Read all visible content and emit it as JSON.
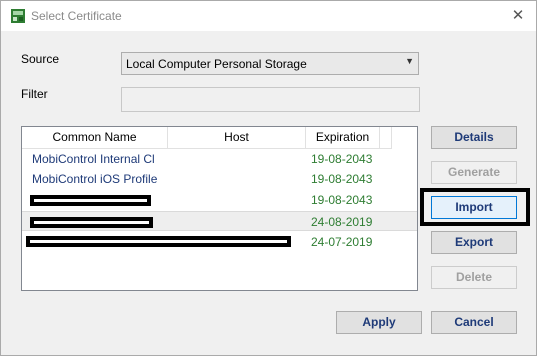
{
  "window": {
    "title": "Select Certificate",
    "close_glyph": "✕",
    "app_icon": "certificate-app-icon"
  },
  "source": {
    "label": "Source",
    "value": "Local Computer Personal Storage",
    "arrow": "▼"
  },
  "filter": {
    "label": "Filter",
    "value": ""
  },
  "list": {
    "columns": [
      "Common Name",
      "Host",
      "Expiration"
    ],
    "rows": [
      {
        "name": "MobiControl Internal Cl",
        "host": "",
        "expiration": "19-08-2043",
        "redacted": false
      },
      {
        "name": "MobiControl iOS Profile",
        "host": "",
        "expiration": "19-08-2043",
        "redacted": false
      },
      {
        "name": "",
        "host": "",
        "expiration": "19-08-2043",
        "redacted": true
      },
      {
        "name": "",
        "host": "",
        "expiration": "24-08-2019",
        "redacted": true,
        "selected": true
      },
      {
        "name": "",
        "host": "",
        "expiration": "24-07-2019",
        "redacted": true
      }
    ]
  },
  "buttons": {
    "details": "Details",
    "generate": "Generate",
    "import": "Import",
    "export": "Export",
    "delete": "Delete",
    "apply": "Apply",
    "cancel": "Cancel"
  },
  "colors": {
    "link_text": "#1e3a78",
    "expiration_text": "#2e7d32",
    "disabled_text": "#a0a0a0"
  }
}
